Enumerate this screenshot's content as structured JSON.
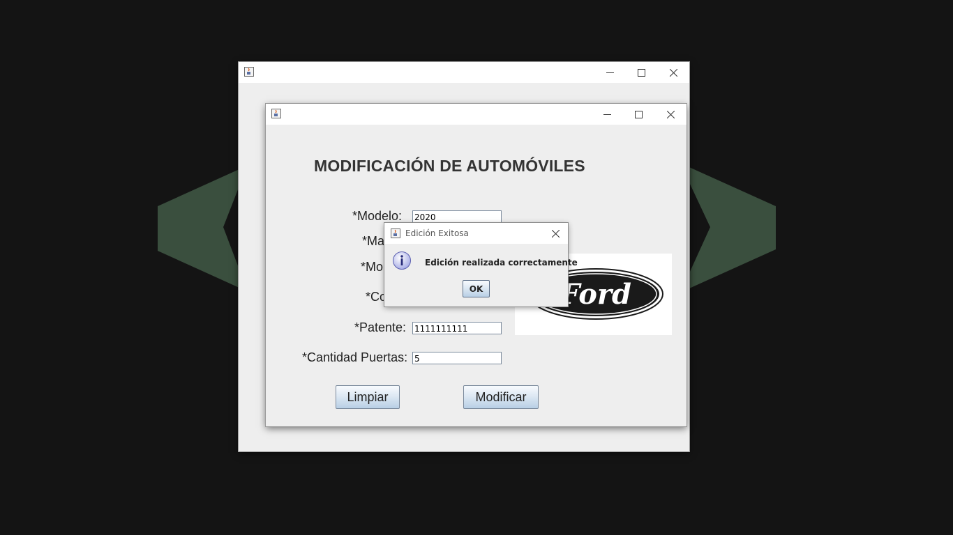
{
  "colors": {
    "desktop_bg": "#141414",
    "chevron_green": "#3a4f3e",
    "window_bg": "#eeeeee"
  },
  "outer_window": {
    "icon": "java-coffee-icon",
    "controls": [
      "minimize-icon",
      "maximize-icon",
      "close-icon"
    ]
  },
  "inner_window": {
    "icon": "java-coffee-icon",
    "controls": [
      "minimize-icon",
      "maximize-icon",
      "close-icon"
    ],
    "heading": "MODIFICACIÓN DE AUTOMÓVILES",
    "labels": {
      "modelo": "*Modelo:",
      "marca_partial": "*Ma",
      "motor_partial": "*Mo",
      "color_partial": "*Co",
      "patente": "*Patente:",
      "cantidad_puertas": "*Cantidad Puertas:"
    },
    "fields": {
      "modelo": "2020",
      "patente": "1111111111",
      "cantidad_puertas": "5"
    },
    "buttons": {
      "limpiar": "Limpiar",
      "modificar": "Modificar"
    },
    "logo": {
      "brand_text": "Ford"
    }
  },
  "dialog": {
    "icon": "java-coffee-icon",
    "title": "Edición Exitosa",
    "message_icon": "info-icon",
    "message": "Edición realizada correctamente",
    "ok_label": "OK"
  }
}
